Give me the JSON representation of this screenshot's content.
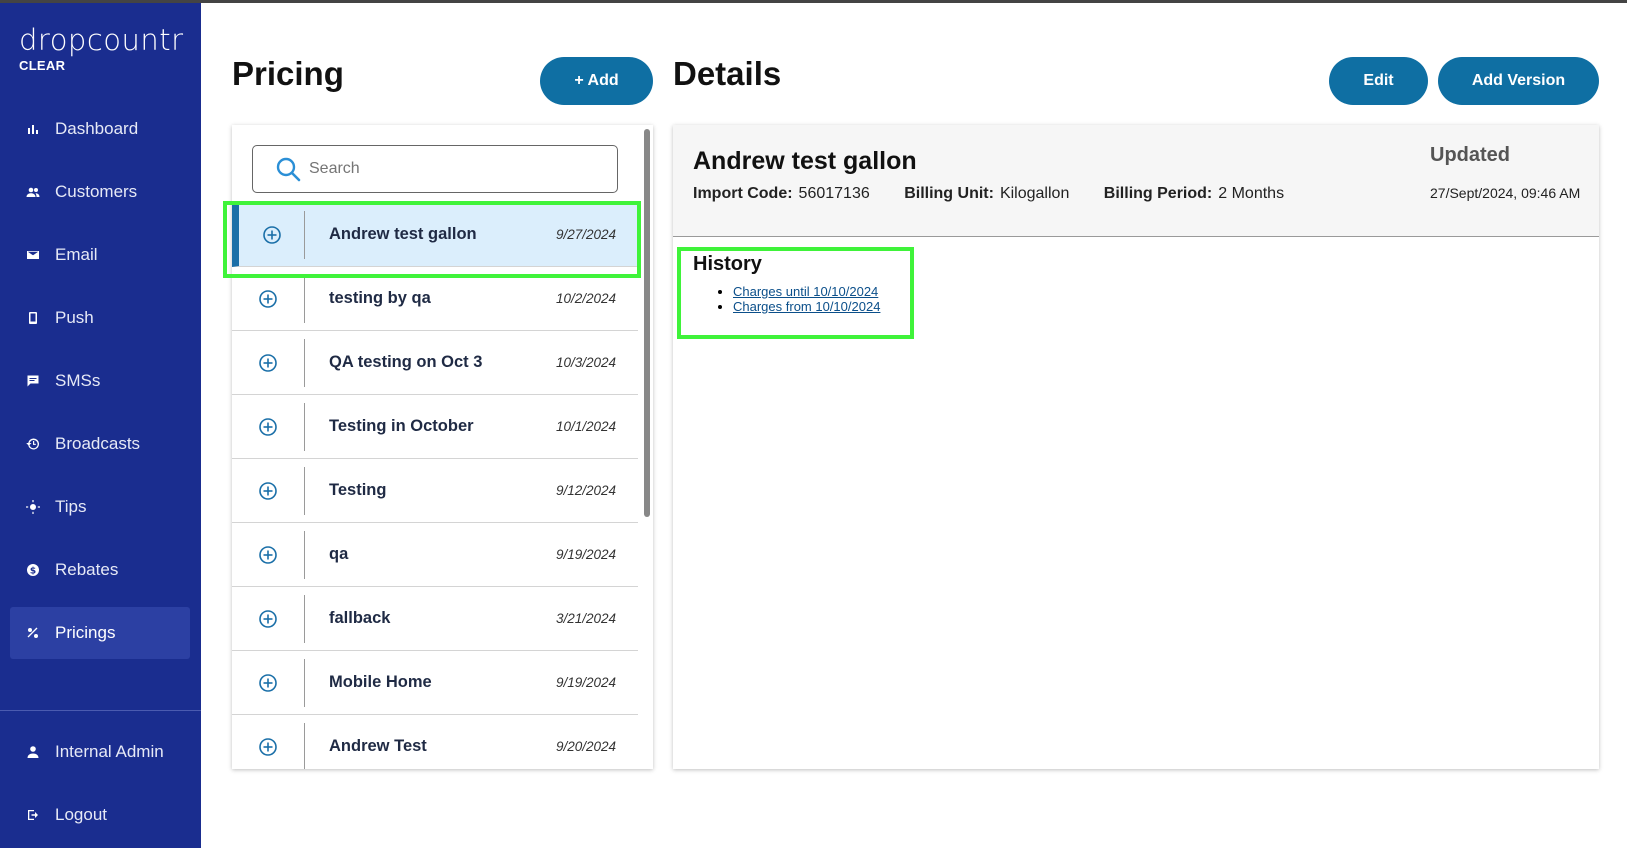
{
  "sidebar": {
    "brand": "dropcountr",
    "brand_sub": "CLEAR",
    "items": [
      {
        "label": "Dashboard",
        "icon": "bar-chart-icon"
      },
      {
        "label": "Customers",
        "icon": "people-icon"
      },
      {
        "label": "Email",
        "icon": "mail-icon"
      },
      {
        "label": "Push",
        "icon": "phone-icon"
      },
      {
        "label": "SMSs",
        "icon": "message-icon"
      },
      {
        "label": "Broadcasts",
        "icon": "history-icon"
      },
      {
        "label": "Tips",
        "icon": "sun-icon"
      },
      {
        "label": "Rebates",
        "icon": "dollar-circle-icon"
      },
      {
        "label": "Pricings",
        "icon": "pricing-icon",
        "active": true
      }
    ],
    "bottom": [
      {
        "label": "Internal Admin",
        "icon": "person-icon"
      },
      {
        "label": "Logout",
        "icon": "logout-icon"
      }
    ]
  },
  "pricing": {
    "title": "Pricing",
    "add_label": "+ Add",
    "search_placeholder": "Search",
    "items": [
      {
        "name": "Andrew test gallon",
        "date": "9/27/2024",
        "selected": true
      },
      {
        "name": "testing by qa",
        "date": "10/2/2024"
      },
      {
        "name": "QA testing on Oct 3",
        "date": "10/3/2024"
      },
      {
        "name": "Testing in October",
        "date": "10/1/2024"
      },
      {
        "name": "Testing",
        "date": "9/12/2024"
      },
      {
        "name": "qa",
        "date": "9/19/2024"
      },
      {
        "name": "fallback",
        "date": "3/21/2024"
      },
      {
        "name": "Mobile Home",
        "date": "9/19/2024"
      },
      {
        "name": "Andrew Test",
        "date": "9/20/2024"
      }
    ]
  },
  "details": {
    "title": "Details",
    "edit_label": "Edit",
    "add_version_label": "Add Version",
    "name": "Andrew test gallon",
    "import_code_label": "Import Code:",
    "import_code": "56017136",
    "billing_unit_label": "Billing Unit:",
    "billing_unit": "Kilogallon",
    "billing_period_label": "Billing Period:",
    "billing_period": "2 Months",
    "updated_label": "Updated",
    "updated_date": "27/Sept/2024, 09:46 AM",
    "history_title": "History",
    "history": [
      "Charges until 10/10/2024",
      "Charges from 10/10/2024"
    ]
  },
  "colors": {
    "sidebar": "#1a2d8f",
    "accent": "#0f6fa3",
    "highlight": "#3ff33a",
    "selected_row": "#dbeefc"
  }
}
